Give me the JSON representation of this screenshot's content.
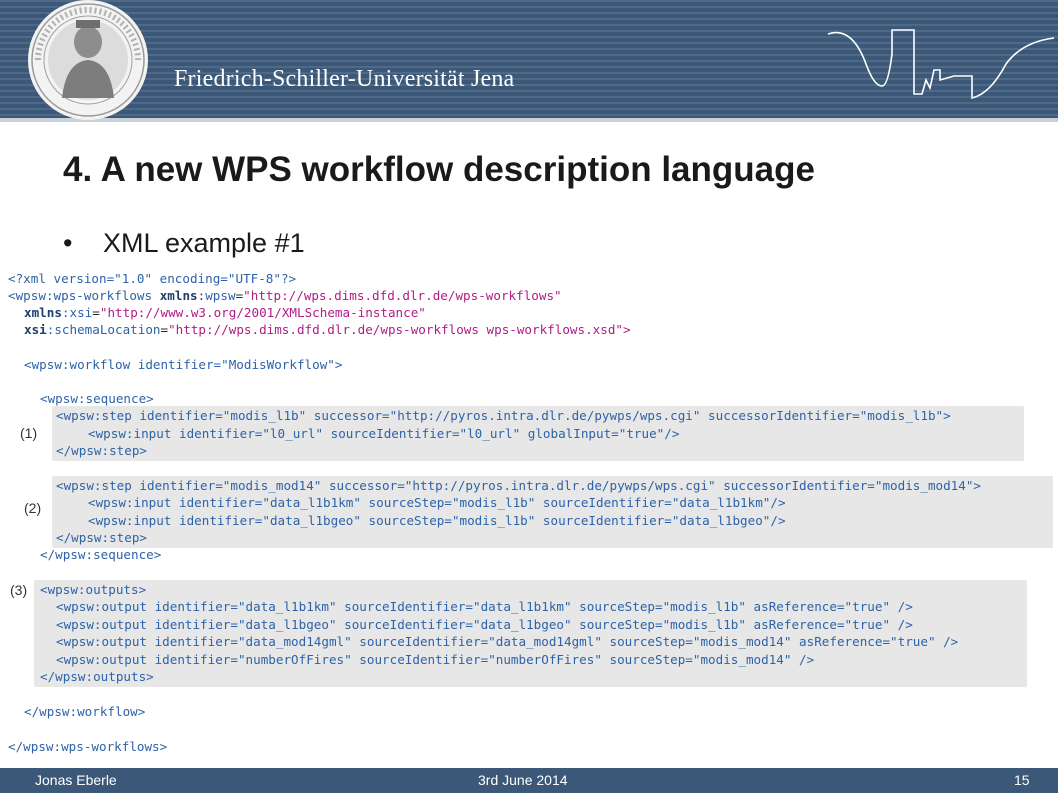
{
  "header": {
    "university_name": "Friedrich-Schiller-Universität Jena",
    "colors": {
      "bar": "#3b5878",
      "accent_text": "#ffffff"
    }
  },
  "slide": {
    "title": "4. A new WPS workflow description language",
    "bullet_char": "•",
    "bullet_text": "XML example #1"
  },
  "code": {
    "xml_decl": "<?xml version=\"1.0\" encoding=\"UTF-8\"?>",
    "l1_open": "<",
    "l1_ns": "wpsw",
    "l1_colon": ":",
    "l1_tag": "wps-workflows",
    "l1_attr1_ns": "xmlns",
    "l1_attr1_colon": ":",
    "l1_attr1_name": "wpsw",
    "l1_attr1_value": "\"http://wps.dims.dfd.dlr.de/wps-workflows\"",
    "l2_attr_ns": "xmlns",
    "l2_attr_name": ":xsi",
    "l2_attr_value": "\"http://www.w3.org/2001/XMLSchema-instance\"",
    "l3_attr_ns": "xsi",
    "l3_attr_name": ":schemaLocation",
    "l3_attr_value": "\"http://wps.dims.dfd.dlr.de/wps-workflows wps-workflows.xsd\">",
    "workflow_open": "<wpsw:workflow identifier=\"ModisWorkflow\">",
    "sequence_open": "<wpsw:sequence>",
    "step1_open": "<wpsw:step identifier=\"modis_l1b\" successor=\"http://pyros.intra.dlr.de/pywps/wps.cgi\" successorIdentifier=\"modis_l1b\">",
    "step1_input": "<wpsw:input identifier=\"l0_url\" sourceIdentifier=\"l0_url\" globalInput=\"true\"/>",
    "step_close": "</wpsw:step>",
    "step2_open": "<wpsw:step identifier=\"modis_mod14\" successor=\"http://pyros.intra.dlr.de/pywps/wps.cgi\" successorIdentifier=\"modis_mod14\">",
    "step2_input1": "<wpsw:input identifier=\"data_l1b1km\" sourceStep=\"modis_l1b\" sourceIdentifier=\"data_l1b1km\"/>",
    "step2_input2": "<wpsw:input identifier=\"data_l1bgeo\" sourceStep=\"modis_l1b\" sourceIdentifier=\"data_l1bgeo\"/>",
    "sequence_close": "</wpsw:sequence>",
    "outputs_open": "<wpsw:outputs>",
    "out1": "<wpsw:output identifier=\"data_l1b1km\" sourceIdentifier=\"data_l1b1km\" sourceStep=\"modis_l1b\" asReference=\"true\" />",
    "out2": "<wpsw:output identifier=\"data_l1bgeo\" sourceIdentifier=\"data_l1bgeo\" sourceStep=\"modis_l1b\" asReference=\"true\" />",
    "out3": "<wpsw:output identifier=\"data_mod14gml\" sourceIdentifier=\"data_mod14gml\" sourceStep=\"modis_mod14\" asReference=\"true\" />",
    "out4": "<wpsw:output identifier=\"numberOfFires\" sourceIdentifier=\"numberOfFires\" sourceStep=\"modis_mod14\" />",
    "outputs_close": "</wpsw:outputs>",
    "workflow_close": "</wpsw:workflow>",
    "workflows_close": "</wpsw:wps-workflows>"
  },
  "labels": {
    "step1": "(1)",
    "step2": "(2)",
    "step3": "(3)"
  },
  "footer": {
    "author": "Jonas Eberle",
    "date": "3rd June 2014",
    "page": "15"
  }
}
